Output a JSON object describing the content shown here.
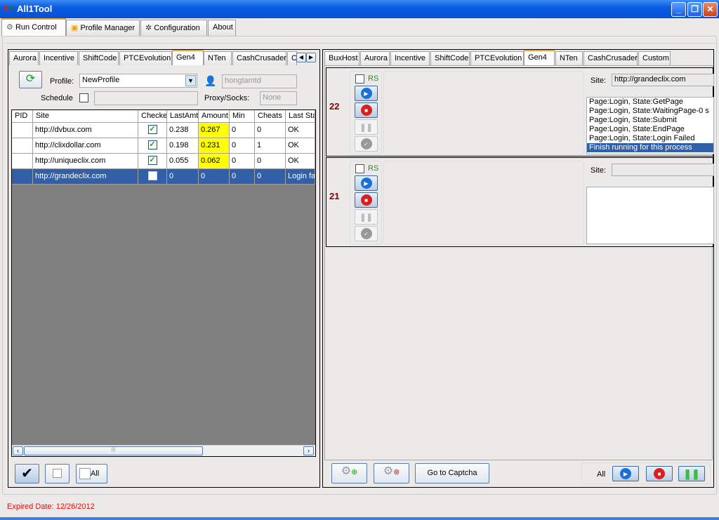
{
  "app": {
    "title": "All1Tool",
    "logo": "A1"
  },
  "main_tabs": [
    {
      "label": "Run Control",
      "icon": "gear-icon"
    },
    {
      "label": "Profile Manager",
      "icon": "profile-icon"
    },
    {
      "label": "Configuration",
      "icon": "config-icon"
    },
    {
      "label": "About"
    }
  ],
  "left": {
    "tabs": [
      "Aurora",
      "Incentive",
      "ShiftCode",
      "PTCEvolution",
      "Gen4",
      "NTen",
      "CashCrusader",
      "C"
    ],
    "active_tab": "Gen4",
    "profile_label": "Profile:",
    "profile_value": "NewProfile",
    "user_value": "hongtamtd",
    "schedule_label": "Schedule",
    "proxy_label": "Proxy/Socks:",
    "proxy_value": "None",
    "columns": [
      "PID",
      "Site",
      "Checked",
      "LastAmt",
      "Amount",
      "Min",
      "Cheats",
      "Last Status"
    ],
    "rows": [
      {
        "pid": "",
        "site": "http://dvbux.com",
        "checked": true,
        "lastamt": "0.238",
        "amount": "0.267",
        "min": "0",
        "cheats": "0",
        "status": "OK"
      },
      {
        "pid": "",
        "site": "http://clixdollar.com",
        "checked": true,
        "lastamt": "0.198",
        "amount": "0.231",
        "min": "0",
        "cheats": "1",
        "status": "OK"
      },
      {
        "pid": "",
        "site": "http://uniqueclix.com",
        "checked": true,
        "lastamt": "0.055",
        "amount": "0.062",
        "min": "0",
        "cheats": "0",
        "status": "OK"
      },
      {
        "pid": "",
        "site": "http://grandeclix.com",
        "checked": false,
        "lastamt": "0",
        "amount": "0",
        "min": "0",
        "cheats": "0",
        "status": "Login failed",
        "selected": true
      }
    ],
    "all_label": "All"
  },
  "right": {
    "tabs": [
      "BuxHost",
      "Aurora",
      "Incentive",
      "ShiftCode",
      "PTCEvolution",
      "Gen4",
      "NTen",
      "CashCrusader",
      "Custom"
    ],
    "active_tab": "Gen4",
    "processes": [
      {
        "id": "22",
        "rs_label": "RS",
        "site_label": "Site:",
        "site": "http://grandeclix.com",
        "log": [
          "Page:Login, State:GetPage",
          "Page:Login, State:WaitingPage-0 s",
          "Page:Login, State:Submit",
          "Page:Login, State:EndPage",
          "Page:Login, State:Login Failed",
          "Finish running for this process"
        ]
      },
      {
        "id": "21",
        "rs_label": "RS",
        "site_label": "Site:",
        "site": "",
        "log": []
      }
    ],
    "captcha_label": "Go to Captcha",
    "all_label": "All"
  },
  "status": {
    "expired": "Expired Date: 12/26/2012"
  },
  "colors": {
    "highlight": "#ffff00",
    "selection": "#3160a8",
    "expired": "#ff0000"
  }
}
